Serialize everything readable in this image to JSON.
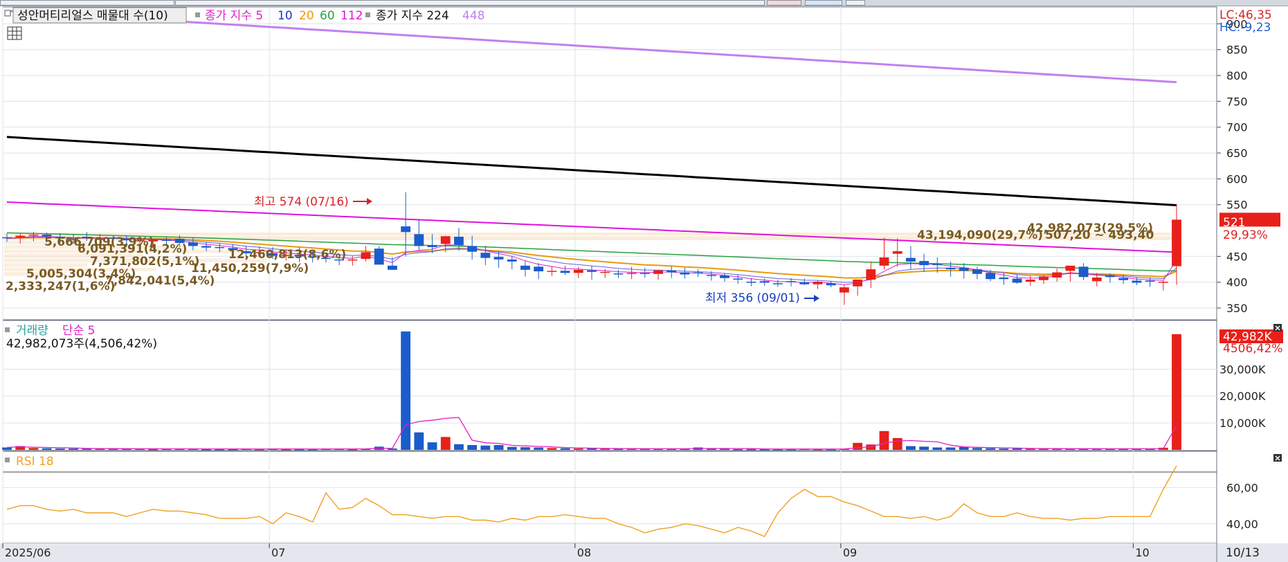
{
  "price_panel": {
    "legend": {
      "title": "성안머티리얼스 매물대 수(10)",
      "ma_prefix": "종가 지수 5",
      "ma_10": "10",
      "ma_20": "20",
      "ma_60": "60",
      "ma_112": "112",
      "ma2_prefix": "종가 지수 224",
      "ma_448": "448"
    },
    "lc_label": "LC:46,35",
    "hc_label": "HC:-9,23",
    "current_price": "521",
    "current_change": "29,93%",
    "high_note": "최고 574 (07/16)",
    "low_note": "최저 356 (09/01)",
    "volume_profile": [
      "43,194,090(29,7%)",
      "42,982,073(29,5%)",
      "507,20 ~ 493,40",
      "5,666,709(3,9%)",
      "6,091,391(4,2%)",
      "12,460,813(8,6%)",
      "7,371,802(5,1%)",
      "11,450,259(7,9%)",
      "5,005,304(3,4%)",
      "7,842,041(5,4%)",
      "2,333,247(1,6%)"
    ],
    "y_ticks": [
      "900",
      "850",
      "800",
      "750",
      "700",
      "650",
      "600",
      "550",
      "450",
      "400",
      "350"
    ]
  },
  "volume_panel": {
    "title": "거래량",
    "ma_label": "단순 5",
    "info": "42,982,073주(4,506,42%)",
    "current": "42,982K",
    "current_pct": "4506,42%",
    "y_ticks": [
      "30,000K",
      "20,000K",
      "10,000K"
    ]
  },
  "rsi_panel": {
    "title": "RSI 18",
    "y_ticks": [
      "60,00",
      "40,00"
    ]
  },
  "x_axis": {
    "labels": [
      "2025/06",
      "07",
      "08",
      "09",
      "10"
    ],
    "right_label": "10/13"
  },
  "colors": {
    "up": "#e8201a",
    "down": "#1a5ccc",
    "ma5": "#e020c8",
    "ma10": "#6060e0",
    "ma20": "#e89a10",
    "ma60": "#28a040",
    "ma112": "#e010e0",
    "ma224": "#000000",
    "ma448": "#c080f0",
    "rsi": "#f0a020"
  },
  "chart_data": [
    {
      "type": "candlestick",
      "title": "성안머티리얼스",
      "ylim": [
        330,
        930
      ],
      "x": [
        "06/02",
        "06/03",
        "06/04",
        "06/05",
        "06/09",
        "06/10",
        "06/11",
        "06/12",
        "06/13",
        "06/16",
        "06/17",
        "06/18",
        "06/19",
        "06/20",
        "06/23",
        "06/24",
        "06/25",
        "06/26",
        "06/27",
        "06/30",
        "07/01",
        "07/02",
        "07/03",
        "07/04",
        "07/07",
        "07/08",
        "07/09",
        "07/10",
        "07/11",
        "07/14",
        "07/15",
        "07/16",
        "07/17",
        "07/18",
        "07/21",
        "07/22",
        "07/23",
        "07/24",
        "07/25",
        "07/28",
        "07/29",
        "07/30",
        "07/31",
        "08/01",
        "08/04",
        "08/05",
        "08/06",
        "08/07",
        "08/08",
        "08/11",
        "08/12",
        "08/13",
        "08/14",
        "08/18",
        "08/19",
        "08/20",
        "08/21",
        "08/22",
        "08/25",
        "08/26",
        "08/27",
        "08/28",
        "08/29",
        "09/01",
        "09/02",
        "09/03",
        "09/04",
        "09/05",
        "09/08",
        "09/09",
        "09/10",
        "09/11",
        "09/12",
        "09/15",
        "09/16",
        "09/17",
        "09/18",
        "09/19",
        "09/22",
        "09/23",
        "09/24",
        "09/25",
        "09/26",
        "09/29",
        "09/30",
        "10/01",
        "10/02",
        "10/10",
        "10/13"
      ],
      "open": [
        487,
        487,
        490,
        492,
        488,
        484,
        488,
        484,
        486,
        484,
        481,
        479,
        482,
        484,
        477,
        470,
        468,
        466,
        460,
        457,
        456,
        452,
        453,
        450,
        447,
        444,
        442,
        445,
        465,
        432,
        508,
        493,
        472,
        474,
        488,
        470,
        457,
        449,
        444,
        432,
        430,
        420,
        422,
        418,
        423,
        418,
        417,
        417,
        418,
        416,
        423,
        419,
        419,
        414,
        413,
        407,
        401,
        402,
        398,
        402,
        400,
        396,
        398,
        380,
        392,
        405,
        432,
        455,
        447,
        441,
        435,
        428,
        428,
        425,
        418,
        409,
        407,
        401,
        404,
        409,
        422,
        430,
        402,
        413,
        408,
        403,
        403,
        399,
        431
      ],
      "high": [
        494,
        494,
        497,
        496,
        495,
        493,
        497,
        493,
        491,
        490,
        490,
        484,
        488,
        491,
        486,
        478,
        475,
        473,
        470,
        469,
        468,
        463,
        467,
        460,
        454,
        453,
        450,
        470,
        470,
        448,
        574,
        522,
        493,
        490,
        505,
        490,
        470,
        460,
        451,
        441,
        437,
        431,
        432,
        430,
        432,
        426,
        424,
        430,
        428,
        423,
        431,
        428,
        425,
        421,
        418,
        414,
        408,
        407,
        405,
        408,
        407,
        404,
        402,
        395,
        397,
        440,
        486,
        485,
        470,
        455,
        448,
        440,
        437,
        430,
        424,
        418,
        415,
        412,
        414,
        426,
        428,
        437,
        418,
        417,
        414,
        409,
        409,
        403,
        550
      ],
      "low": [
        478,
        475,
        479,
        477,
        476,
        474,
        480,
        475,
        475,
        472,
        468,
        465,
        471,
        468,
        462,
        460,
        458,
        455,
        447,
        448,
        445,
        442,
        439,
        438,
        438,
        433,
        432,
        440,
        440,
        424,
        450,
        462,
        456,
        458,
        461,
        444,
        433,
        428,
        425,
        411,
        406,
        412,
        414,
        408,
        405,
        408,
        408,
        406,
        409,
        405,
        408,
        407,
        410,
        403,
        401,
        397,
        392,
        393,
        391,
        392,
        394,
        387,
        390,
        356,
        374,
        389,
        425,
        430,
        425,
        420,
        418,
        411,
        407,
        406,
        402,
        395,
        397,
        393,
        397,
        401,
        401,
        404,
        392,
        399,
        397,
        394,
        391,
        384,
        395
      ],
      "close": [
        485,
        490,
        492,
        489,
        485,
        482,
        485,
        484,
        484,
        481,
        481,
        482,
        480,
        476,
        470,
        467,
        466,
        462,
        456,
        458,
        451,
        453,
        450,
        449,
        445,
        442,
        444,
        458,
        434,
        424,
        497,
        470,
        468,
        489,
        472,
        459,
        447,
        444,
        440,
        424,
        421,
        422,
        418,
        424,
        420,
        420,
        415,
        418,
        416,
        423,
        419,
        415,
        417,
        412,
        408,
        405,
        399,
        399,
        396,
        400,
        396,
        401,
        394,
        390,
        405,
        425,
        448,
        460,
        440,
        433,
        433,
        425,
        422,
        416,
        406,
        406,
        399,
        405,
        411,
        419,
        432,
        410,
        409,
        410,
        404,
        399,
        402,
        401,
        521
      ]
    },
    {
      "type": "bar",
      "title": "거래량",
      "ylim": [
        0,
        45000
      ],
      "unit": "K",
      "x": [
        "06/02",
        "06/03",
        "06/04",
        "06/05",
        "06/09",
        "06/10",
        "06/11",
        "06/12",
        "06/13",
        "06/16",
        "06/17",
        "06/18",
        "06/19",
        "06/20",
        "06/23",
        "06/24",
        "06/25",
        "06/26",
        "06/27",
        "06/30",
        "07/01",
        "07/02",
        "07/03",
        "07/04",
        "07/07",
        "07/08",
        "07/09",
        "07/10",
        "07/11",
        "07/14",
        "07/15",
        "07/16",
        "07/17",
        "07/18",
        "07/21",
        "07/22",
        "07/23",
        "07/24",
        "07/25",
        "07/28",
        "07/29",
        "07/30",
        "07/31",
        "08/01",
        "08/04",
        "08/05",
        "08/06",
        "08/07",
        "08/08",
        "08/11",
        "08/12",
        "08/13",
        "08/14",
        "08/18",
        "08/19",
        "08/20",
        "08/21",
        "08/22",
        "08/25",
        "08/26",
        "08/27",
        "08/28",
        "08/29",
        "09/01",
        "09/02",
        "09/03",
        "09/04",
        "09/05",
        "09/08",
        "09/09",
        "09/10",
        "09/11",
        "09/12",
        "09/15",
        "09/16",
        "09/17",
        "09/18",
        "09/19",
        "09/22",
        "09/23",
        "09/24",
        "09/25",
        "09/26",
        "09/29",
        "09/30",
        "10/01",
        "10/02",
        "10/10",
        "10/13"
      ],
      "values": [
        900,
        1400,
        700,
        600,
        500,
        500,
        400,
        500,
        400,
        400,
        400,
        300,
        400,
        400,
        400,
        300,
        300,
        300,
        400,
        300,
        400,
        300,
        300,
        300,
        400,
        400,
        300,
        500,
        1200,
        500,
        44000,
        6500,
        2800,
        4800,
        2100,
        1800,
        1600,
        1800,
        1100,
        1000,
        900,
        700,
        600,
        500,
        500,
        400,
        500,
        400,
        400,
        400,
        400,
        500,
        900,
        400,
        400,
        300,
        300,
        300,
        300,
        300,
        400,
        300,
        300,
        400,
        2600,
        2000,
        7000,
        4400,
        1400,
        1200,
        900,
        900,
        1100,
        700,
        600,
        500,
        500,
        400,
        500,
        400,
        400,
        500,
        400,
        400,
        400,
        400,
        400,
        800,
        42982
      ],
      "series_ma5_name": "단순 5"
    },
    {
      "type": "line",
      "title": "RSI 18",
      "ylim": [
        30,
        75
      ],
      "x": [
        "06/02",
        "06/03",
        "06/04",
        "06/05",
        "06/09",
        "06/10",
        "06/11",
        "06/12",
        "06/13",
        "06/16",
        "06/17",
        "06/18",
        "06/19",
        "06/20",
        "06/23",
        "06/24",
        "06/25",
        "06/26",
        "06/27",
        "06/30",
        "07/01",
        "07/02",
        "07/03",
        "07/04",
        "07/07",
        "07/08",
        "07/09",
        "07/10",
        "07/11",
        "07/14",
        "07/15",
        "07/16",
        "07/17",
        "07/18",
        "07/21",
        "07/22",
        "07/23",
        "07/24",
        "07/25",
        "07/28",
        "07/29",
        "07/30",
        "07/31",
        "08/01",
        "08/04",
        "08/05",
        "08/06",
        "08/07",
        "08/08",
        "08/11",
        "08/12",
        "08/13",
        "08/14",
        "08/18",
        "08/19",
        "08/20",
        "08/21",
        "08/22",
        "08/25",
        "08/26",
        "08/27",
        "08/28",
        "08/29",
        "09/01",
        "09/02",
        "09/03",
        "09/04",
        "09/05",
        "09/08",
        "09/09",
        "09/10",
        "09/11",
        "09/12",
        "09/15",
        "09/16",
        "09/17",
        "09/18",
        "09/19",
        "09/22",
        "09/23",
        "09/24",
        "09/25",
        "09/26",
        "09/29",
        "09/30",
        "10/01",
        "10/02",
        "10/10",
        "10/13"
      ],
      "values": [
        48,
        50,
        50,
        48,
        47,
        48,
        46,
        46,
        46,
        44,
        46,
        48,
        47,
        47,
        46,
        45,
        43,
        43,
        43,
        44,
        40,
        46,
        44,
        41,
        57,
        48,
        49,
        54,
        50,
        45,
        45,
        44,
        43,
        44,
        44,
        42,
        42,
        41,
        43,
        42,
        44,
        44,
        45,
        44,
        43,
        43,
        40,
        38,
        35,
        37,
        38,
        40,
        39,
        37,
        35,
        38,
        36,
        33,
        46,
        54,
        59,
        55,
        55,
        52,
        50,
        47,
        44,
        44,
        43,
        44,
        42,
        44,
        51,
        46,
        44,
        44,
        46,
        44,
        43,
        43,
        42,
        43,
        43,
        44,
        44,
        44,
        44,
        59,
        72
      ]
    }
  ]
}
